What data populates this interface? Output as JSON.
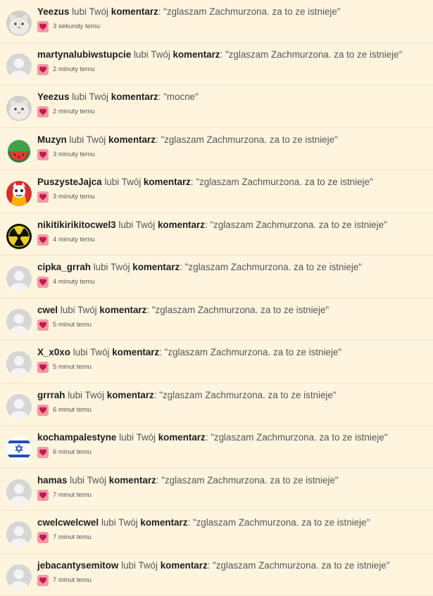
{
  "notifications": [
    {
      "user": "Yeezus",
      "action": "lubi Twój",
      "object": "komentarz",
      "quote": ": \"zglaszam Zachmurzona. za to ze istnieje\"",
      "time": "3 sekundy temu",
      "avatar": "hamster-avatar"
    },
    {
      "user": "martynalubiwstupcie",
      "action": "lubi Twój",
      "object": "komentarz",
      "quote": ": \"zglaszam Zachmurzona. za to ze istnieje\"",
      "time": "2 minuty temu",
      "avatar": "default-avatar"
    },
    {
      "user": "Yeezus",
      "action": "lubi Twój",
      "object": "komentarz",
      "quote": ": \"mocne\"",
      "time": "2 minuty temu",
      "avatar": "hamster-avatar"
    },
    {
      "user": "Muzyn",
      "action": "lubi Twój",
      "object": "komentarz",
      "quote": ": \"zglaszam Zachmurzona. za to ze istnieje\"",
      "time": "3 minuty temu",
      "avatar": "watermelon-avatar"
    },
    {
      "user": "PuszysteJajca",
      "action": "lubi Twój",
      "object": "komentarz",
      "quote": ": \"zglaszam Zachmurzona. za to ze istnieje\"",
      "time": "3 minuty temu",
      "avatar": "cartoon-avatar"
    },
    {
      "user": "nikitikirikitocwel3",
      "action": "lubi Twój",
      "object": "komentarz",
      "quote": ": \"zglaszam Zachmurzona. za to ze istnieje\"",
      "time": "4 minuty temu",
      "avatar": "radiation-avatar"
    },
    {
      "user": "cipka_grrah",
      "action": "lubi Twój",
      "object": "komentarz",
      "quote": ": \"zglaszam Zachmurzona. za to ze istnieje\"",
      "time": "4 minuty temu",
      "avatar": "default-avatar"
    },
    {
      "user": "cwel",
      "action": "lubi Twój",
      "object": "komentarz",
      "quote": ": \"zglaszam Zachmurzona. za to ze istnieje\"",
      "time": "5 minut temu",
      "avatar": "default-avatar"
    },
    {
      "user": "X_x0xo",
      "action": "lubi Twój",
      "object": "komentarz",
      "quote": ": \"zglaszam Zachmurzona. za to ze istnieje\"",
      "time": "5 minut temu",
      "avatar": "default-avatar"
    },
    {
      "user": "grrrah",
      "action": "lubi Twój",
      "object": "komentarz",
      "quote": ": \"zglaszam Zachmurzona. za to ze istnieje\"",
      "time": "6 minut temu",
      "avatar": "default-avatar"
    },
    {
      "user": "kochampalestyne",
      "action": "lubi Twój",
      "object": "komentarz",
      "quote": ": \"zglaszam Zachmurzona. za to ze istnieje\"",
      "time": "6 minut temu",
      "avatar": "flag-avatar"
    },
    {
      "user": "hamas",
      "action": "lubi Twój",
      "object": "komentarz",
      "quote": ": \"zglaszam Zachmurzona. za to ze istnieje\"",
      "time": "7 minut temu",
      "avatar": "default-avatar"
    },
    {
      "user": "cwelcwelcwel",
      "action": "lubi Twój",
      "object": "komentarz",
      "quote": ": \"zglaszam Zachmurzona. za to ze istnieje\"",
      "time": "7 minut temu",
      "avatar": "default-avatar"
    },
    {
      "user": "jebacantysemitow",
      "action": "lubi Twój",
      "object": "komentarz",
      "quote": ": \"zglaszam Zachmurzona. za to ze istnieje\"",
      "time": "7 minut temu",
      "avatar": "default-avatar"
    }
  ],
  "colors": {
    "background": "#fff5df",
    "heart_badge": "#f39a9e",
    "heart": "#c2185b"
  }
}
